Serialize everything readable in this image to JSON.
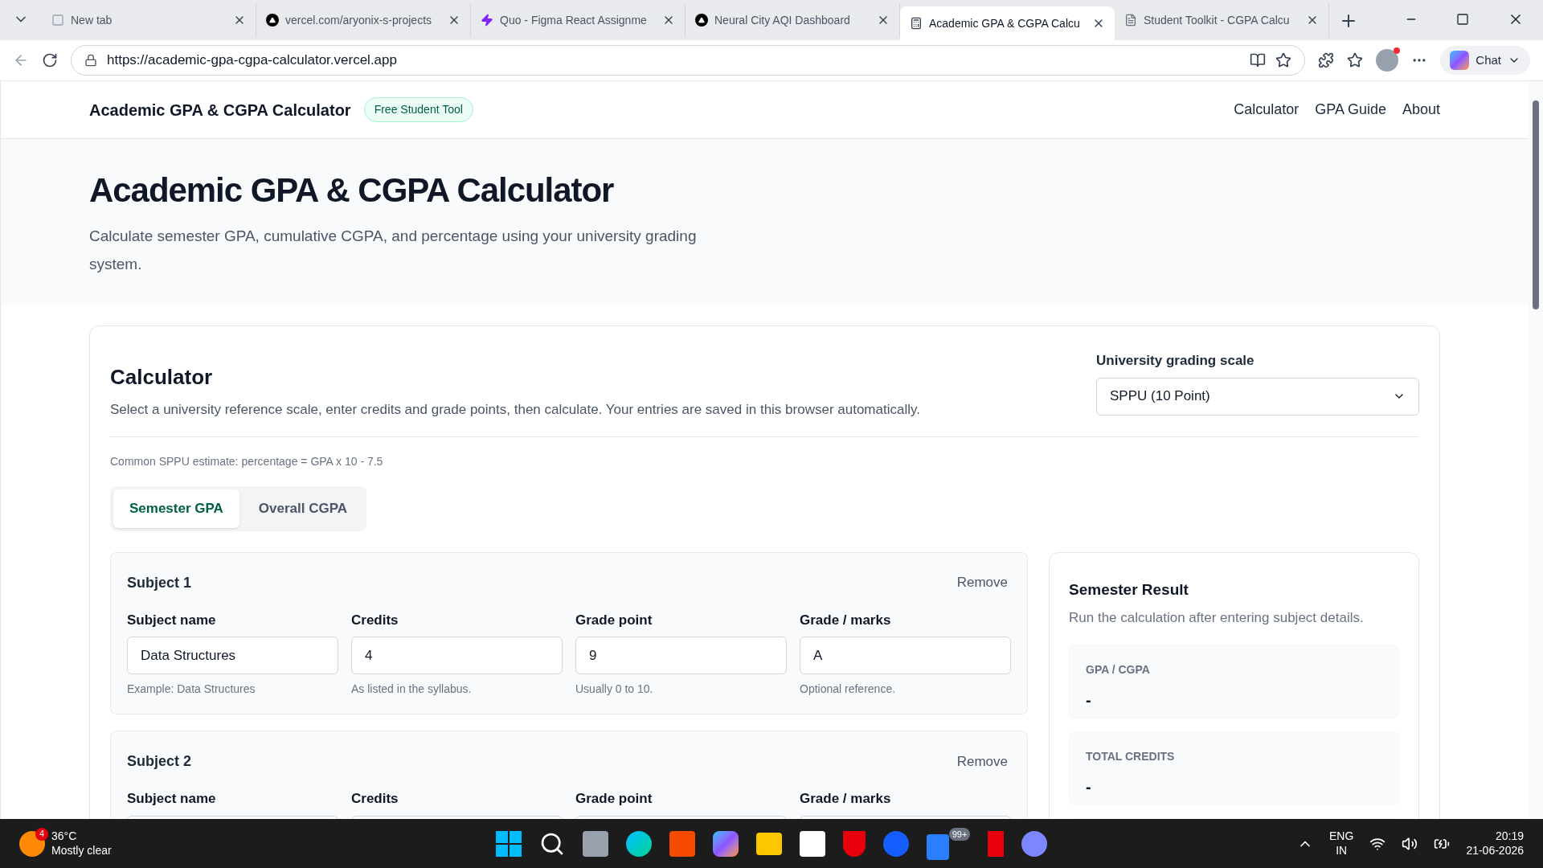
{
  "browser": {
    "tabs": [
      {
        "title": "New tab",
        "selected": false,
        "kind": "newtab"
      },
      {
        "title": "vercel.com/aryonix-s-projects",
        "selected": false,
        "kind": "triangle"
      },
      {
        "title": "Quo - Figma React Assignme",
        "selected": false,
        "kind": "bolt"
      },
      {
        "title": "Neural City AQI Dashboard",
        "selected": false,
        "kind": "triangle"
      },
      {
        "title": "Academic GPA & CGPA Calcu",
        "selected": true,
        "kind": "calc"
      },
      {
        "title": "Student Toolkit - CGPA Calcu",
        "selected": false,
        "kind": "doc"
      }
    ],
    "url": "https://academic-gpa-cgpa-calculator.vercel.app",
    "chat": "Chat"
  },
  "site_header": {
    "brand": "Academic GPA & CGPA Calculator",
    "badge": "Free Student Tool",
    "nav": [
      "Calculator",
      "GPA Guide",
      "About"
    ]
  },
  "hero": {
    "title": "Academic GPA & CGPA Calculator",
    "subtitle": "Calculate semester GPA, cumulative CGPA, and percentage using your university grading system."
  },
  "calculator": {
    "title": "Calculator",
    "description": "Select a university reference scale, enter credits and grade points, then calculate. Your entries are saved in this browser automatically.",
    "scale_label": "University grading scale",
    "scale_value": "SPPU (10 Point)",
    "note": "Common SPPU estimate: percentage = GPA x 10 - 7.5",
    "modes": [
      {
        "label": "Semester GPA",
        "selected": true
      },
      {
        "label": "Overall CGPA",
        "selected": false
      }
    ],
    "subjects": [
      {
        "title": "Subject 1",
        "remove": "Remove",
        "fields": [
          {
            "label": "Subject name",
            "value": "Data Structures",
            "hint": "Example: Data Structures"
          },
          {
            "label": "Credits",
            "value": "4",
            "hint": "As listed in the syllabus."
          },
          {
            "label": "Grade point",
            "value": "9",
            "hint": "Usually 0 to 10."
          },
          {
            "label": "Grade / marks",
            "value": "A",
            "hint": "Optional reference."
          }
        ]
      },
      {
        "title": "Subject 2",
        "remove": "Remove",
        "fields": [
          {
            "label": "Subject name"
          },
          {
            "label": "Credits"
          },
          {
            "label": "Grade point"
          },
          {
            "label": "Grade / marks"
          }
        ]
      }
    ],
    "result": {
      "title": "Semester Result",
      "description": "Run the calculation after entering subject details.",
      "stats": [
        {
          "label": "GPA / CGPA",
          "value": "-"
        },
        {
          "label": "TOTAL CREDITS",
          "value": "-"
        }
      ]
    }
  },
  "taskbar": {
    "weather": {
      "temp": "36°C",
      "condition": "Mostly clear",
      "badge": "4"
    },
    "mail_badge": "99+",
    "tray": {
      "lang": "ENG",
      "region": "IN",
      "time": "20:19",
      "date": "21-06-2026"
    }
  }
}
